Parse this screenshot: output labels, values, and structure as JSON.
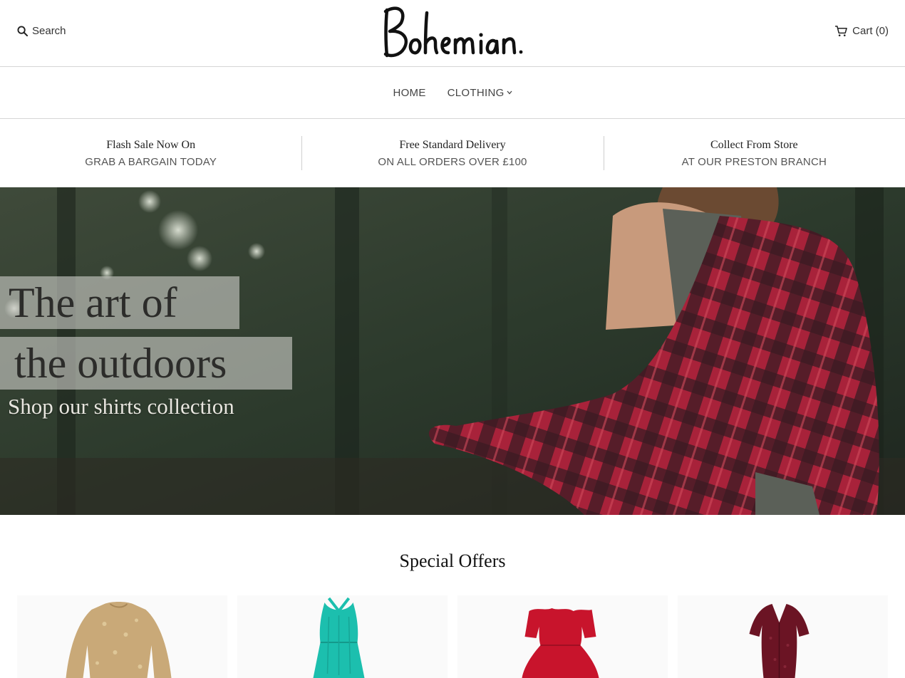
{
  "header": {
    "search_label": "Search",
    "cart_label": "Cart (0)",
    "logo_text": "Bohemian."
  },
  "nav": {
    "items": [
      {
        "label": "HOME"
      },
      {
        "label": "CLOTHING"
      }
    ]
  },
  "usp": [
    {
      "title": "Flash Sale Now On",
      "subtitle": "GRAB A BARGAIN TODAY"
    },
    {
      "title": "Free Standard Delivery",
      "subtitle": "ON ALL ORDERS OVER £100"
    },
    {
      "title": "Collect From Store",
      "subtitle": "AT OUR PRESTON BRANCH"
    }
  ],
  "hero": {
    "line1": "The art of",
    "line2": "the outdoors",
    "cta": "Shop our shirts collection"
  },
  "special_offers": {
    "title": "Special Offers",
    "products": [
      {
        "icon": "gold-sequin-dress-image",
        "color": "#c9a978"
      },
      {
        "icon": "teal-halter-dress-image",
        "color": "#1cbfae"
      },
      {
        "icon": "red-off-shoulder-dress-image",
        "color": "#c8142c"
      },
      {
        "icon": "burgundy-sequin-dress-image",
        "color": "#6b1424"
      }
    ]
  },
  "colors": {
    "border": "#d6d6d6",
    "text": "#222222"
  }
}
